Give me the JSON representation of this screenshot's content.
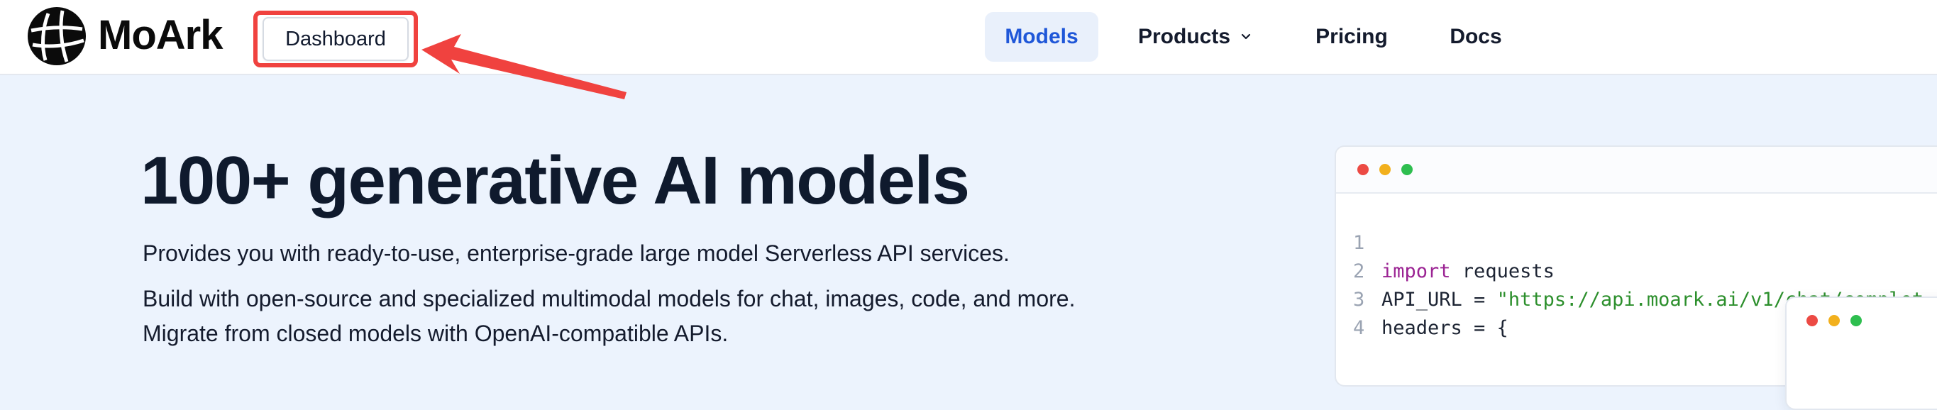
{
  "brand": {
    "name": "MoArk",
    "logo_icon": "moark-globe-logo-icon"
  },
  "header": {
    "dashboard_label": "Dashboard",
    "nav": {
      "models": "Models",
      "products": "Products",
      "pricing": "Pricing",
      "docs": "Docs"
    },
    "annotation_color": "#f0423f",
    "active_color": "#1f57d8"
  },
  "hero": {
    "title": "100+ generative AI models",
    "subtitle": "Provides you with ready-to-use, enterprise-grade large model Serverless API services.",
    "description_line1": "Build with open-source and specialized multimodal models for chat, images, code, and more.",
    "description_line2": "Migrate from closed models with OpenAI-compatible APIs."
  },
  "code_panel": {
    "window_dots": [
      "#ec4a44",
      "#f2b01d",
      "#2ebe4f"
    ],
    "lines": [
      {
        "number": "1",
        "keyword": "import",
        "text": " requests"
      },
      {
        "number": "2",
        "text": "API_URL = ",
        "string": "\"https://api.moark.ai/v1/chat/complet"
      },
      {
        "number": "3",
        "text": "headers = {"
      },
      {
        "number": "4",
        "text": ""
      }
    ]
  }
}
